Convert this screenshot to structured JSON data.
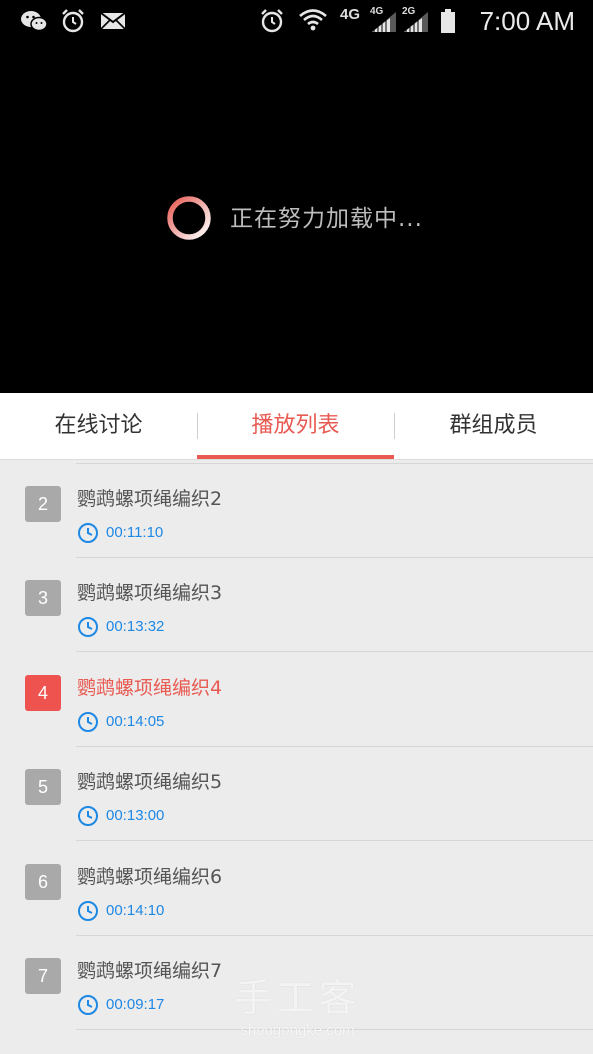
{
  "status_bar": {
    "time": "7:00 AM",
    "network_label_1": "4G",
    "network_label_2": "4G",
    "network_label_3": "2G",
    "icons": [
      "wechat-icon",
      "alarm-icon",
      "mail-icon",
      "alarm-icon",
      "wifi-icon",
      "signal-icon",
      "signal-icon",
      "battery-icon"
    ]
  },
  "video": {
    "loading_text": "正在努力加载中..."
  },
  "tabs": [
    {
      "label": "在线讨论",
      "active": false
    },
    {
      "label": "播放列表",
      "active": true
    },
    {
      "label": "群组成员",
      "active": false
    }
  ],
  "playlist": [
    {
      "number": "2",
      "title": "鹦鹉螺项绳编织2",
      "duration": "00:11:10",
      "active": false
    },
    {
      "number": "3",
      "title": "鹦鹉螺项绳编织3",
      "duration": "00:13:32",
      "active": false
    },
    {
      "number": "4",
      "title": "鹦鹉螺项绳编织4",
      "duration": "00:14:05",
      "active": true
    },
    {
      "number": "5",
      "title": "鹦鹉螺项绳编织5",
      "duration": "00:13:00",
      "active": false
    },
    {
      "number": "6",
      "title": "鹦鹉螺项绳编织6",
      "duration": "00:14:10",
      "active": false
    },
    {
      "number": "7",
      "title": "鹦鹉螺项绳编织7",
      "duration": "00:09:17",
      "active": false
    }
  ],
  "watermark": {
    "cn": "手工客",
    "en": "shougongke.com"
  },
  "colors": {
    "accent": "#e85a52",
    "badge_default": "#a9a9a9",
    "badge_active": "#ef5350",
    "duration_blue": "#1e88e5"
  }
}
